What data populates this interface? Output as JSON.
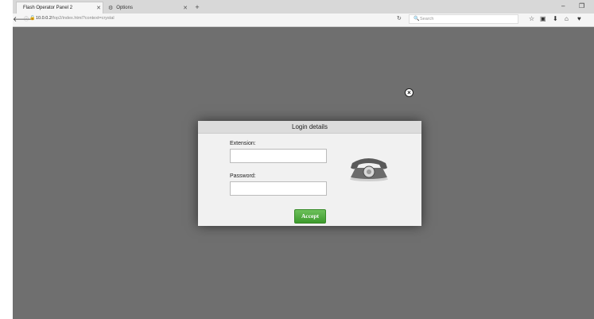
{
  "browser": {
    "tabs": [
      {
        "label": "Flash Operator Panel 2"
      },
      {
        "label": "Options"
      }
    ],
    "new_tab": "+",
    "window_minimize": "–",
    "window_restore": "❐",
    "url_host": "10.0.0.2",
    "url_path": "/fop2/index.html?context=crystal",
    "search_placeholder": "Search"
  },
  "dialog": {
    "title": "Login details",
    "extension_label": "Extension:",
    "extension_value": "",
    "password_label": "Password:",
    "password_value": "",
    "accept_label": "Accept"
  },
  "colors": {
    "overlay": "#6f6f6f",
    "accept_button": "#4caf3a",
    "dialog_bg": "#f1f1f1"
  }
}
